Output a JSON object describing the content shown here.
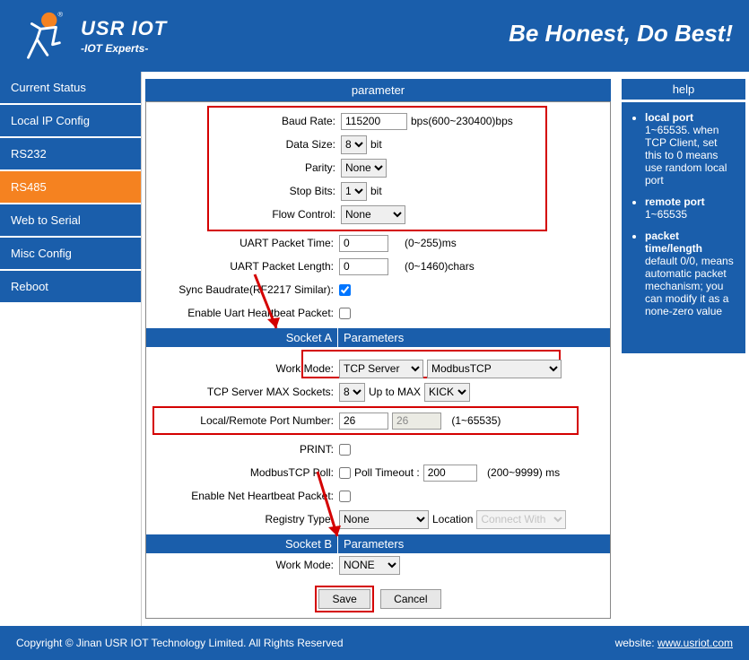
{
  "header": {
    "brand": "USR IOT",
    "sub": "-IOT Experts-",
    "slogan": "Be Honest, Do Best!"
  },
  "sidebar": {
    "items": [
      {
        "label": "Current Status"
      },
      {
        "label": "Local IP Config"
      },
      {
        "label": "RS232"
      },
      {
        "label": "RS485"
      },
      {
        "label": "Web to Serial"
      },
      {
        "label": "Misc Config"
      },
      {
        "label": "Reboot"
      }
    ]
  },
  "main": {
    "title": "parameter",
    "serial": {
      "baud_lbl": "Baud Rate:",
      "baud_val": "115200",
      "baud_hint": "bps(600~230400)bps",
      "data_lbl": "Data Size:",
      "data_val": "8",
      "data_hint": "bit",
      "parity_lbl": "Parity:",
      "parity_val": "None",
      "stop_lbl": "Stop Bits:",
      "stop_val": "1",
      "stop_hint": "bit",
      "flow_lbl": "Flow Control:",
      "flow_val": "None"
    },
    "uart": {
      "pkt_time_lbl": "UART Packet Time:",
      "pkt_time_val": "0",
      "pkt_time_hint": "(0~255)ms",
      "pkt_len_lbl": "UART Packet Length:",
      "pkt_len_val": "0",
      "pkt_len_hint": "(0~1460)chars",
      "sync_lbl": "Sync Baudrate(RF2217 Similar):",
      "hb_lbl": "Enable Uart Heartbeat Packet:"
    },
    "socketA": {
      "hdr_l": "Socket A",
      "hdr_r": "Parameters",
      "work_lbl": "Work Mode:",
      "work_val": "TCP Server",
      "work_val2": "ModbusTCP",
      "max_lbl": "TCP Server MAX Sockets:",
      "max_val": "8",
      "max_mid": "Up to MAX",
      "max_kick": "KICK",
      "port_lbl": "Local/Remote Port Number:",
      "port_local": "26",
      "port_remote": "26",
      "port_hint": "(1~65535)",
      "print_lbl": "PRINT:",
      "poll_lbl": "ModbusTCP Poll:",
      "poll_mid": "Poll Timeout :",
      "poll_val": "200",
      "poll_hint": "(200~9999) ms",
      "nethb_lbl": "Enable Net Heartbeat Packet:",
      "reg_lbl": "Registry Type:",
      "reg_val": "None",
      "reg_loc_lbl": "Location",
      "reg_loc_val": "Connect With"
    },
    "socketB": {
      "hdr_l": "Socket B",
      "hdr_r": "Parameters",
      "work_lbl": "Work Mode:",
      "work_val": "NONE"
    },
    "buttons": {
      "save": "Save",
      "cancel": "Cancel"
    }
  },
  "help": {
    "title": "help",
    "items": [
      {
        "t": "local port",
        "d": "1~65535. when TCP Client, set this to 0 means use random local port"
      },
      {
        "t": "remote port",
        "d": "1~65535"
      },
      {
        "t": "packet time/length",
        "d": "default 0/0, means automatic packet mechanism; you can modify it as a none-zero value"
      }
    ]
  },
  "footer": {
    "copy": "Copyright © Jinan USR IOT Technology Limited. All Rights Reserved",
    "site_lbl": "website:",
    "site": "www.usriot.com"
  }
}
